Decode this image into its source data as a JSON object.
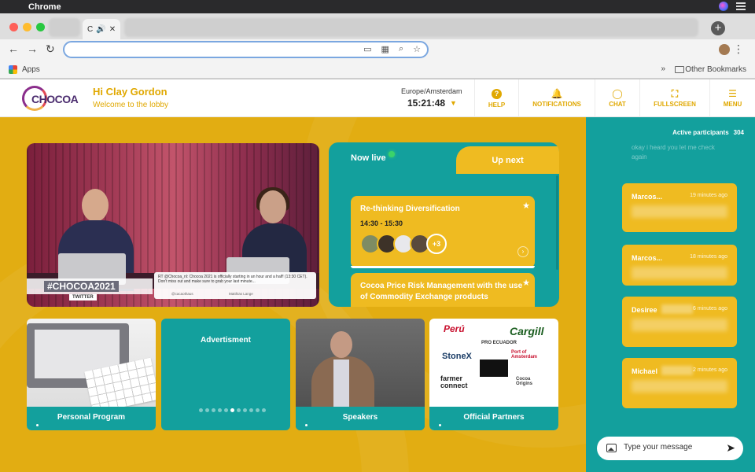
{
  "os": {
    "app_name": "Chrome"
  },
  "browser": {
    "active_tab_label": "C",
    "bookmarks": {
      "apps_label": "Apps",
      "other_label": "Other Bookmarks",
      "overflow": "»"
    }
  },
  "header": {
    "logo_text": "CHOCOA",
    "greeting": "Hi Clay Gordon",
    "welcome": "Welcome to the lobby",
    "timezone": "Europe/Amsterdam",
    "time": "15:21:48",
    "nav": [
      {
        "label": "HELP",
        "icon": "help-icon"
      },
      {
        "label": "NOTIFICATIONS",
        "icon": "bell-icon"
      },
      {
        "label": "CHAT",
        "icon": "chat-bubble-icon"
      },
      {
        "label": "FULLSCREEN",
        "icon": "fullscreen-icon"
      },
      {
        "label": "MENU",
        "icon": "menu-icon"
      }
    ]
  },
  "video": {
    "hashtag": "#CHOCOA2021",
    "source_label": "TWITTER",
    "tweet_text": "RT @Chocoa_nl: Chocoa 2021 is officially starting in an hour and a half! (13:30 CET). Don't miss out and make sure to grab your last minute...",
    "tweet_handle": "@cacaothaus",
    "speaker_name": "Matthias Lange"
  },
  "schedule": {
    "tab_now": "Now live",
    "tab_next": "Up next",
    "sessions": [
      {
        "title": "Re-thinking Diversification",
        "time": "14:30 - 15:30",
        "extra_speakers": "+3"
      },
      {
        "title": "Cocoa Price Risk Management with the use of Commodity Exchange products",
        "time": ""
      }
    ]
  },
  "tiles": {
    "personal_program": "Personal Program",
    "advertisment": "Advertisment",
    "speakers": "Speakers",
    "partners": "Official Partners"
  },
  "partners": [
    "Perú",
    "PRO ECUADOR",
    "Cargill",
    "StoneX",
    "Port of Amsterdam",
    "farmer connect",
    "Cocoa Origins"
  ],
  "chat": {
    "active_label": "Active participants",
    "active_count": "304",
    "faded_message": "okay i heard you let me check again",
    "messages": [
      {
        "name": "Marcos...",
        "ago": "19 minutes ago"
      },
      {
        "name": "Marcos...",
        "ago": "18 minutes ago"
      },
      {
        "name": "Desiree",
        "ago": "6 minutes ago"
      },
      {
        "name": "Michael",
        "ago": "2 minutes ago"
      }
    ],
    "input_placeholder": "Type your message"
  },
  "colors": {
    "gold": "#e2ad12",
    "teal": "#13a09d",
    "card_gold": "#efbb21"
  }
}
